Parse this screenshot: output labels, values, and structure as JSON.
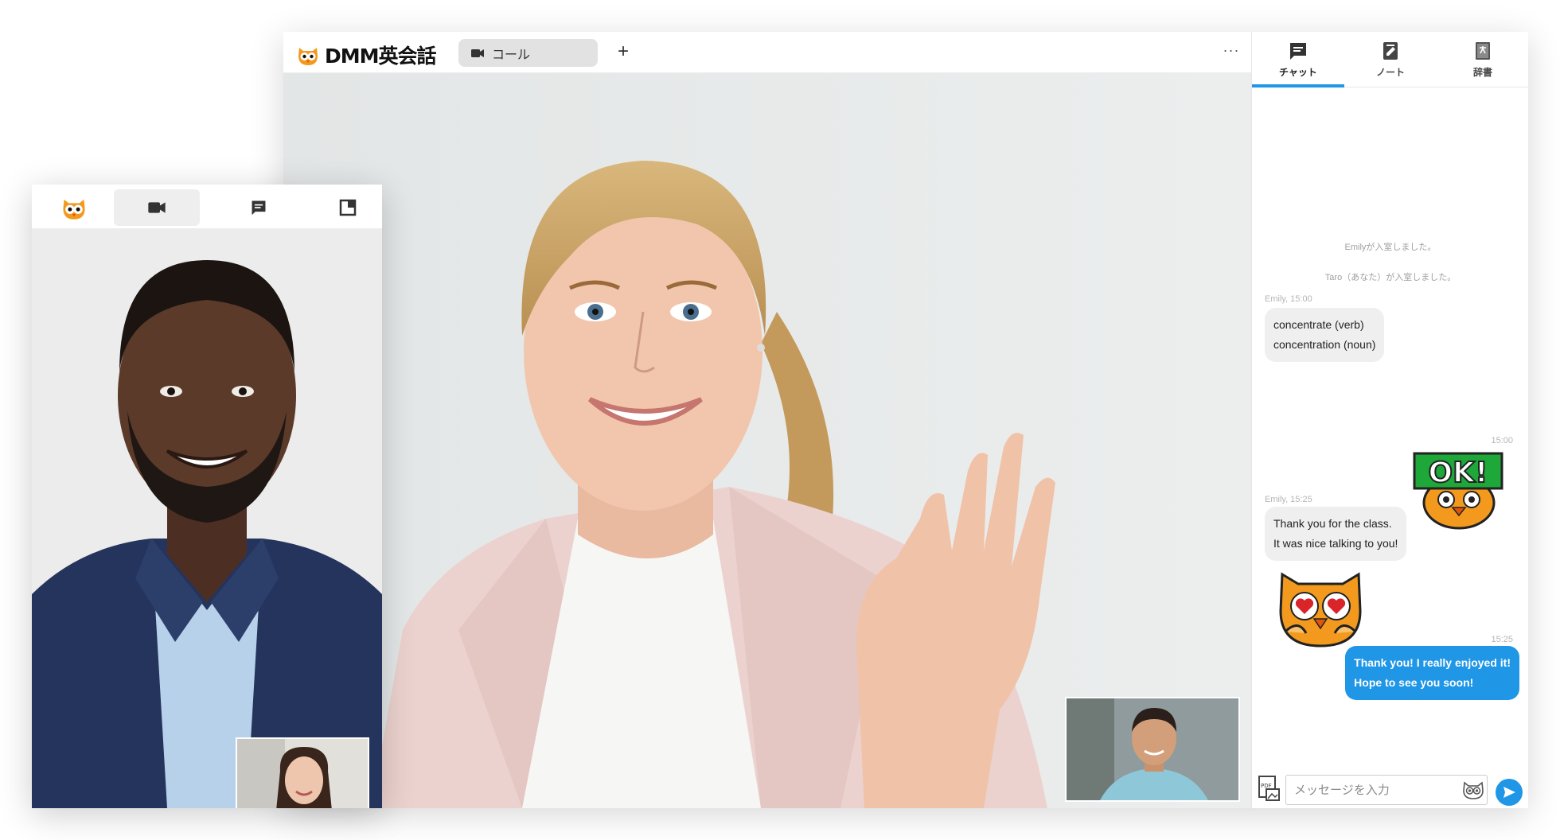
{
  "main_window": {
    "brand": "DMM英会話",
    "call_tab_label": "コール",
    "new_tab_symbol": "+",
    "more_symbol": "···"
  },
  "sidebar": {
    "tabs": [
      {
        "label": "チャット",
        "icon": "chat-icon",
        "active": true
      },
      {
        "label": "ノート",
        "icon": "note-icon",
        "active": false
      },
      {
        "label": "辞書",
        "icon": "dictionary-icon",
        "active": false
      }
    ],
    "system_messages": [
      "Emilyが入室しました。",
      "Taro（あなた）が入室しました。"
    ],
    "messages": [
      {
        "meta": "Emily, 15:00",
        "text": "concentrate (verb)\nconcentration (noun)",
        "from": "Emily"
      },
      {
        "meta": "15:00",
        "sticker": "OK!",
        "from": "me"
      },
      {
        "meta": "Emily, 15:25",
        "text": "Thank you for the class.\nIt was nice talking to you!",
        "from": "Emily"
      },
      {
        "sticker": "owl-heart-eyes-sticker",
        "from": "Emily"
      },
      {
        "meta": "15:25",
        "text": "Thank you! I really enjoyed it!\nHope to see you soon!",
        "from": "me"
      }
    ],
    "composer": {
      "placeholder": "メッセージを入力",
      "attach_icon": "pdf-image-attach-icon",
      "emoji_icon": "owl-face-icon",
      "send_icon": "send-icon"
    }
  },
  "mobile_window": {
    "nav": [
      {
        "icon": "owl-logo-icon"
      },
      {
        "icon": "video-camera-icon",
        "active": true
      },
      {
        "icon": "chat-icon"
      },
      {
        "icon": "pip-icon"
      }
    ]
  },
  "colors": {
    "accent": "#1f96e6",
    "owl_orange": "#f39a1e",
    "sticker_green": "#1ea83a"
  }
}
